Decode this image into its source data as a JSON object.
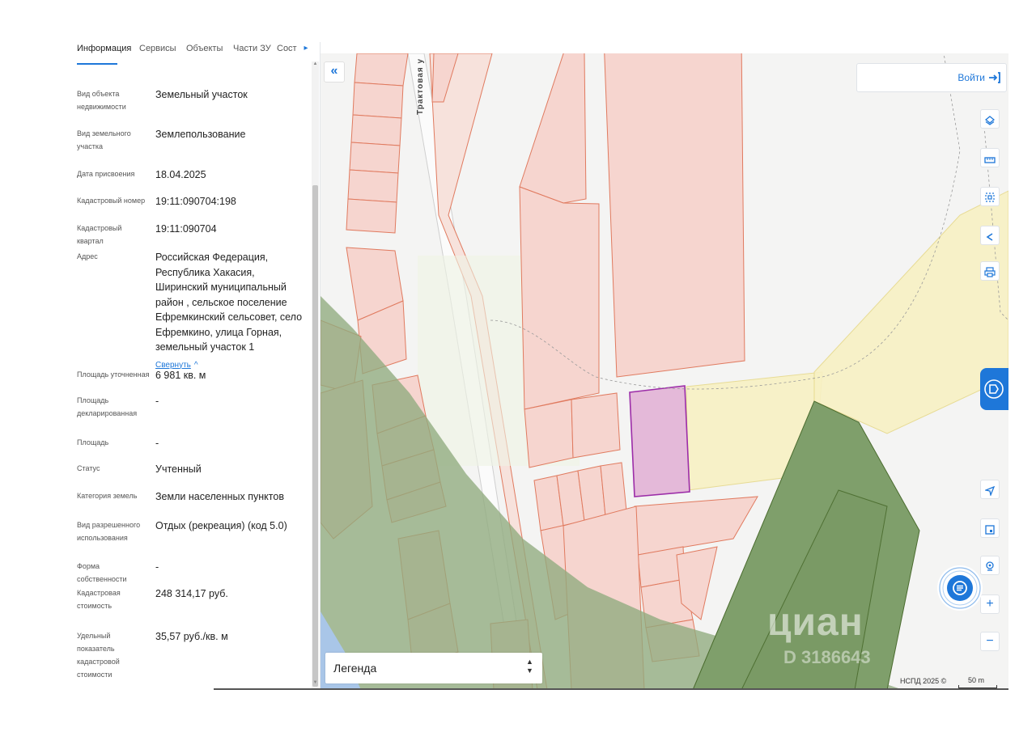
{
  "panel": {
    "tabs": [
      "Информация",
      "Сервисы",
      "Объекты",
      "Части ЗУ",
      "Сост"
    ],
    "rows": [
      {
        "label": "Вид объекта недвижимости",
        "value": "Земельный участок"
      },
      {
        "label": "Вид земельного участка",
        "value": "Землепользование"
      },
      {
        "label": "Дата присвоения",
        "value": "18.04.2025"
      },
      {
        "label": "Кадастровый номер",
        "value": "19:11:090704:198"
      },
      {
        "label": "Кадастровый квартал",
        "value": "19:11:090704"
      },
      {
        "label": "Адрес",
        "value": "Российская Федерация, Республика Хакасия, Ширинский муниципальный район , сельское поселение Ефремкинский сельсовет, село Ефремкино, улица Горная, земельный участок 1"
      },
      {
        "label": "Площадь уточненная",
        "value": "6 981 кв. м"
      },
      {
        "label": "Площадь декларированная",
        "value": "-"
      },
      {
        "label": "Площадь",
        "value": "-"
      },
      {
        "label": "Статус",
        "value": "Учтенный"
      },
      {
        "label": "Категория земель",
        "value": "Земли населенных пунктов"
      },
      {
        "label": "Вид разрешенного использования",
        "value": "Отдых (рекреация) (код 5.0)"
      },
      {
        "label": "Форма собственности",
        "value": "-"
      },
      {
        "label": "Кадастровая стоимость",
        "value": "248 314,17 руб."
      },
      {
        "label": "Удельный показатель кадастровой стоимости",
        "value": "35,57 руб./кв. м"
      }
    ],
    "collapse_label": "Свернуть"
  },
  "map": {
    "collapse_button": "«",
    "login_label": "Войти",
    "road_label": "Трактовая у",
    "legend_label": "Легенда",
    "watermark": "циан",
    "watermark_id": "D 3186643",
    "copyright": "НСПД 2025 ©",
    "scale_label": "50 m",
    "tools": [
      "layers-icon",
      "ruler-icon",
      "area-select-icon",
      "share-icon",
      "print-icon",
      "locate-icon",
      "minimap-icon",
      "location-pin-icon",
      "zoom-in-icon",
      "zoom-out-icon"
    ]
  },
  "colors": {
    "accent": "#1e77d9",
    "parcel_fill": "#f6d5cf",
    "parcel_stroke": "#e07a5f",
    "selected_fill": "#e4b9d9",
    "selected_stroke": "#9c2da8",
    "zone_yellow": "#f8f1c4",
    "forest": "#90aa7e"
  }
}
